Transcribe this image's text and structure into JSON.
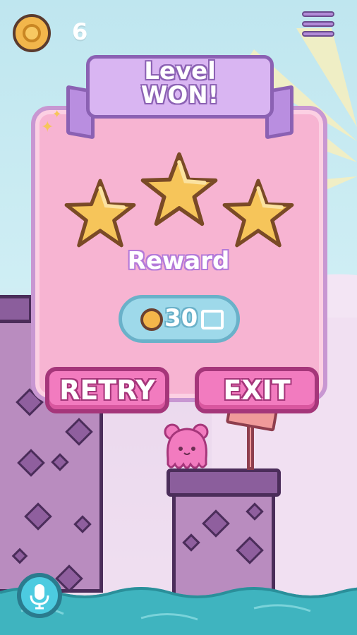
{
  "hud": {
    "coins": "6",
    "coin_icon": "coin-icon",
    "menu_icon": "hamburger-menu-icon"
  },
  "dialog": {
    "title_line1": "Level",
    "title_line2": "WON!",
    "stars_earned": 3,
    "stars_total": 3,
    "reward_label": "Reward",
    "reward_amount": "30",
    "reward_icon": "video-ad-icon"
  },
  "buttons": {
    "retry": "RETRY",
    "exit": "EXIT"
  },
  "footer": {
    "mic_icon": "microphone-icon"
  },
  "colors": {
    "panel": "#f7b4d2",
    "banner": "#d9b5f2",
    "button": "#f27bbf",
    "reward_pill": "#9ed9ea",
    "star": "#f6c55a"
  }
}
